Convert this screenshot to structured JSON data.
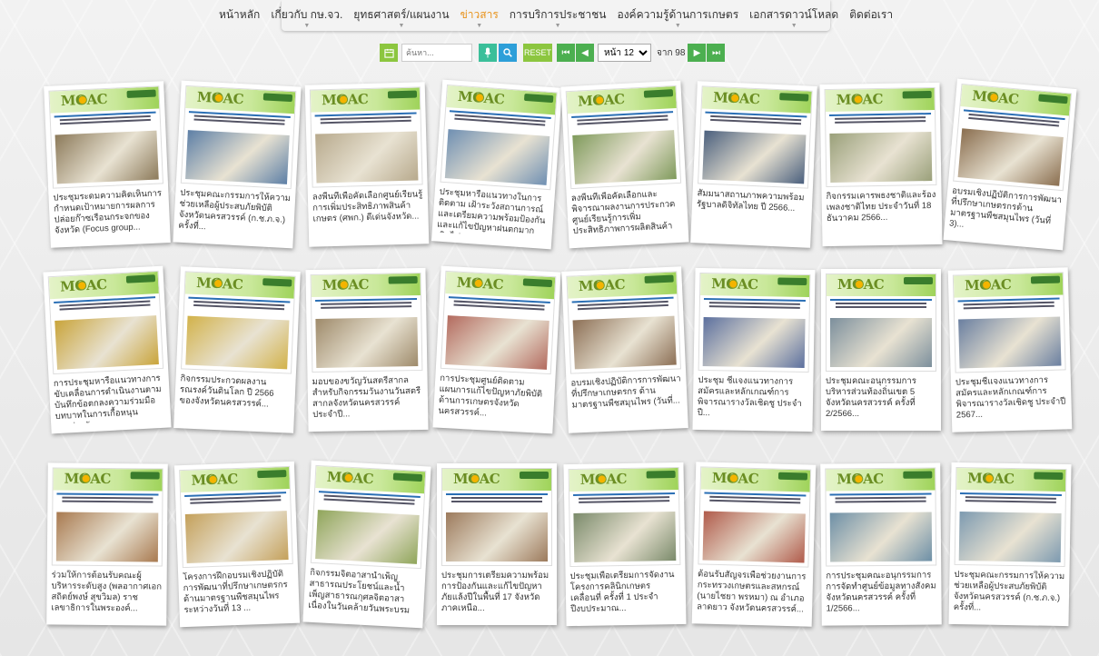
{
  "nav": {
    "items": [
      {
        "label": "หน้าหลัก",
        "has_dropdown": false,
        "active": false
      },
      {
        "label": "เกี่ยวกับ กษ.จว.",
        "has_dropdown": true,
        "active": false
      },
      {
        "label": "ยุทธศาสตร์/แผนงาน",
        "has_dropdown": true,
        "active": false
      },
      {
        "label": "ข่าวสาร",
        "has_dropdown": true,
        "active": true
      },
      {
        "label": "การบริการประชาชน",
        "has_dropdown": true,
        "active": false
      },
      {
        "label": "องค์ความรู้ด้านการเกษตร",
        "has_dropdown": true,
        "active": false
      },
      {
        "label": "เอกสารดาวน์โหลด",
        "has_dropdown": true,
        "active": false
      },
      {
        "label": "ติดต่อเรา",
        "has_dropdown": false,
        "active": false
      }
    ],
    "caret_glyph": "▼"
  },
  "toolbar": {
    "calendar_icon": "calendar-icon",
    "search_placeholder": "ค้นหา...",
    "mic_icon": "microphone-icon",
    "search_icon": "search-icon",
    "reset_label": "RESET",
    "first_glyph": "⏮",
    "prev_glyph": "◀",
    "page_prefix": "หน้า 12",
    "page_options": [
      "หน้า 12"
    ],
    "of_label": "จาก 98",
    "next_glyph": "▶",
    "last_glyph": "⏭"
  },
  "thumb": {
    "logo_text": "MOAC"
  },
  "colors": {
    "accent_active": "#e8921a",
    "green_button": "#8cc63f",
    "blue_button": "#2d9fd9",
    "teal_button": "#3bbf9a",
    "nav_button": "#4caf50"
  },
  "cards": [
    {
      "title": "ประชุมระดมความคิดเห็นการกำหนดเป้าหมายการผลการปล่อยก๊าซเรือนกระจกของจังหวัด (Focus group...",
      "photo": "#8c7a5a"
    },
    {
      "title": "ประชุมคณะกรรมการให้ความช่วยเหลือผู้ประสบภัยพิบัติจังหวัดนครสวรรค์ (ก.ช.ภ.จ.) ครั้งที่...",
      "photo": "#5d7fa6"
    },
    {
      "title": "ลงพื้นที่เพื่อคัดเลือกศูนย์เรียนรู้การเพิ่มประสิทธิภาพสินค้าเกษตร (ศพก.) ดีเด่นจังหวัด...",
      "photo": "#b7a98c"
    },
    {
      "title": "ประชุมหารือแนวทางในการติดตาม เฝ้าระวังสถานการณ์ และเตรียมความพร้อมป้องกัน และแก้ไขปัญหาฝนตกมากเกินไป...",
      "photo": "#6f8fb2"
    },
    {
      "title": "ลงพื้นที่เพื่อคัดเลือกและพิจารณาผลงานการประกวดศูนย์เรียนรู้การเพิ่มประสิทธิภาพการผลิตสินค้าเกษตร...",
      "photo": "#7f9a5b"
    },
    {
      "title": "สัมมนาสถานภาพความพร้อมรัฐบาลดิจิทัลไทย ปี 2566...",
      "photo": "#4a5f7d"
    },
    {
      "title": "กิจกรรมเคารพธงชาติและร้องเพลงชาติไทย ประจำวันที่ 18 ธันวาคม 2566...",
      "photo": "#9aa07a"
    },
    {
      "title": "อบรมเชิงปฏิบัติการการพัฒนาที่ปรึกษาเกษตรกรด้านมาตรฐานพืชสมุนไพร (วันที่ 3)...",
      "photo": "#8a6e4f"
    },
    {
      "title": "การประชุมหารือแนวทางการขับเคลื่อนการดำเนินงานตามบันทึกข้อตกลงความร่วมมือบทบาทในการเกื้อหนุนระหว่างจัง...",
      "photo": "#c9a43a"
    },
    {
      "title": "กิจกรรมประกวดผลงานรณรงค์วันดินโลก ปี 2566 ของจังหวัดนครสวรรค์...",
      "photo": "#d2b24a"
    },
    {
      "title": "มอบของขวัญวันสตรีสากลสำหรับกิจกรรมวันงานวันสตรีสากลจังหวัดนครสวรรค์ ประจำปี...",
      "photo": "#9e8a6a"
    },
    {
      "title": "การประชุมศูนย์ติดตามแผนการแก้ไขปัญหาภัยพิบัติด้านการเกษตรจังหวัดนครสวรรค์...",
      "photo": "#b36a5e"
    },
    {
      "title": "อบรมเชิงปฏิบัติการการพัฒนาที่ปรึกษาเกษตรกร ด้านมาตรฐานพืชสมุนไพร (วันที่...",
      "photo": "#8c6f55"
    },
    {
      "title": "ประชุม ชี้แจงแนวทางการสมัครและหลักเกณฑ์การพิจารณารางวัลเชิดชู ประจำปี...",
      "photo": "#5b6f9e"
    },
    {
      "title": "ประชุมคณะอนุกรรมการบริหารส่วนท้องถิ่นเขต 5 จังหวัดนครสวรรค์ ครั้งที่ 2/2566...",
      "photo": "#7c8f9c"
    },
    {
      "title": "ประชุมชี้แจงแนวทางการสมัครและหลักเกณฑ์การพิจารณารางวัลเชิดชู ประจำปี 2567...",
      "photo": "#6a7fa0"
    },
    {
      "title": "ร่วมให้การต้อนรับคณะผู้บริหารระดับสูง (พลอากาศเอก สถิตย์พงษ์ สุขวิมล) ราชเลขาธิการในพระองค์...",
      "photo": "#a8794f"
    },
    {
      "title": "โครงการฝึกอบรมเชิงปฏิบัติการพัฒนาที่ปรึกษาเกษตรกรด้านมาตรฐานพืชสมุนไพรระหว่างวันที่ 13 ...",
      "photo": "#c4a05a"
    },
    {
      "title": "กิจกรรมจิตอาสาน้ำเพ็ญสาธารณประโยชน์และน้ำเพ็ญสาธารณกุศลจิตอาสา เนื่องในวันคล้ายวันพระบรมราชสมภพพระบาท...",
      "photo": "#8fa55a"
    },
    {
      "title": "ประชุมการเตรียมความพร้อมการป้องกันและแก้ไขปัญหาภัยแล้งปีในพื้นที่ 17 จังหวัดภาคเหนือ...",
      "photo": "#9c7a5c"
    },
    {
      "title": "ประชุมเพื่อเตรียมการจัดงานโครงการคลินิกเกษตรเคลื่อนที่ ครั้งที่ 1 ประจำปีงบประมาณ...",
      "photo": "#7a8a6a"
    },
    {
      "title": "ต้อนรับสัญจรเพื่อช่วยงานการกระทรวงเกษตรและสหกรณ์ (นายไชยา พรหมา) ณ อำเภอลาดยาว จังหวัดนครสวรรค์...",
      "photo": "#b05a4a"
    },
    {
      "title": "การประชุมคณะอนุกรรมการการจัดทำศูนย์ข้อมูลทางสังคมจังหวัดนครสวรรค์ ครั้งที่ 1/2566...",
      "photo": "#6d8fa6"
    },
    {
      "title": "ประชุมคณะกรรมการให้ความช่วยเหลือผู้ประสบภัยพิบัติจังหวัดนครสวรรค์ (ก.ช.ภ.จ.) ครั้งที่...",
      "photo": "#7d9ab0"
    }
  ]
}
